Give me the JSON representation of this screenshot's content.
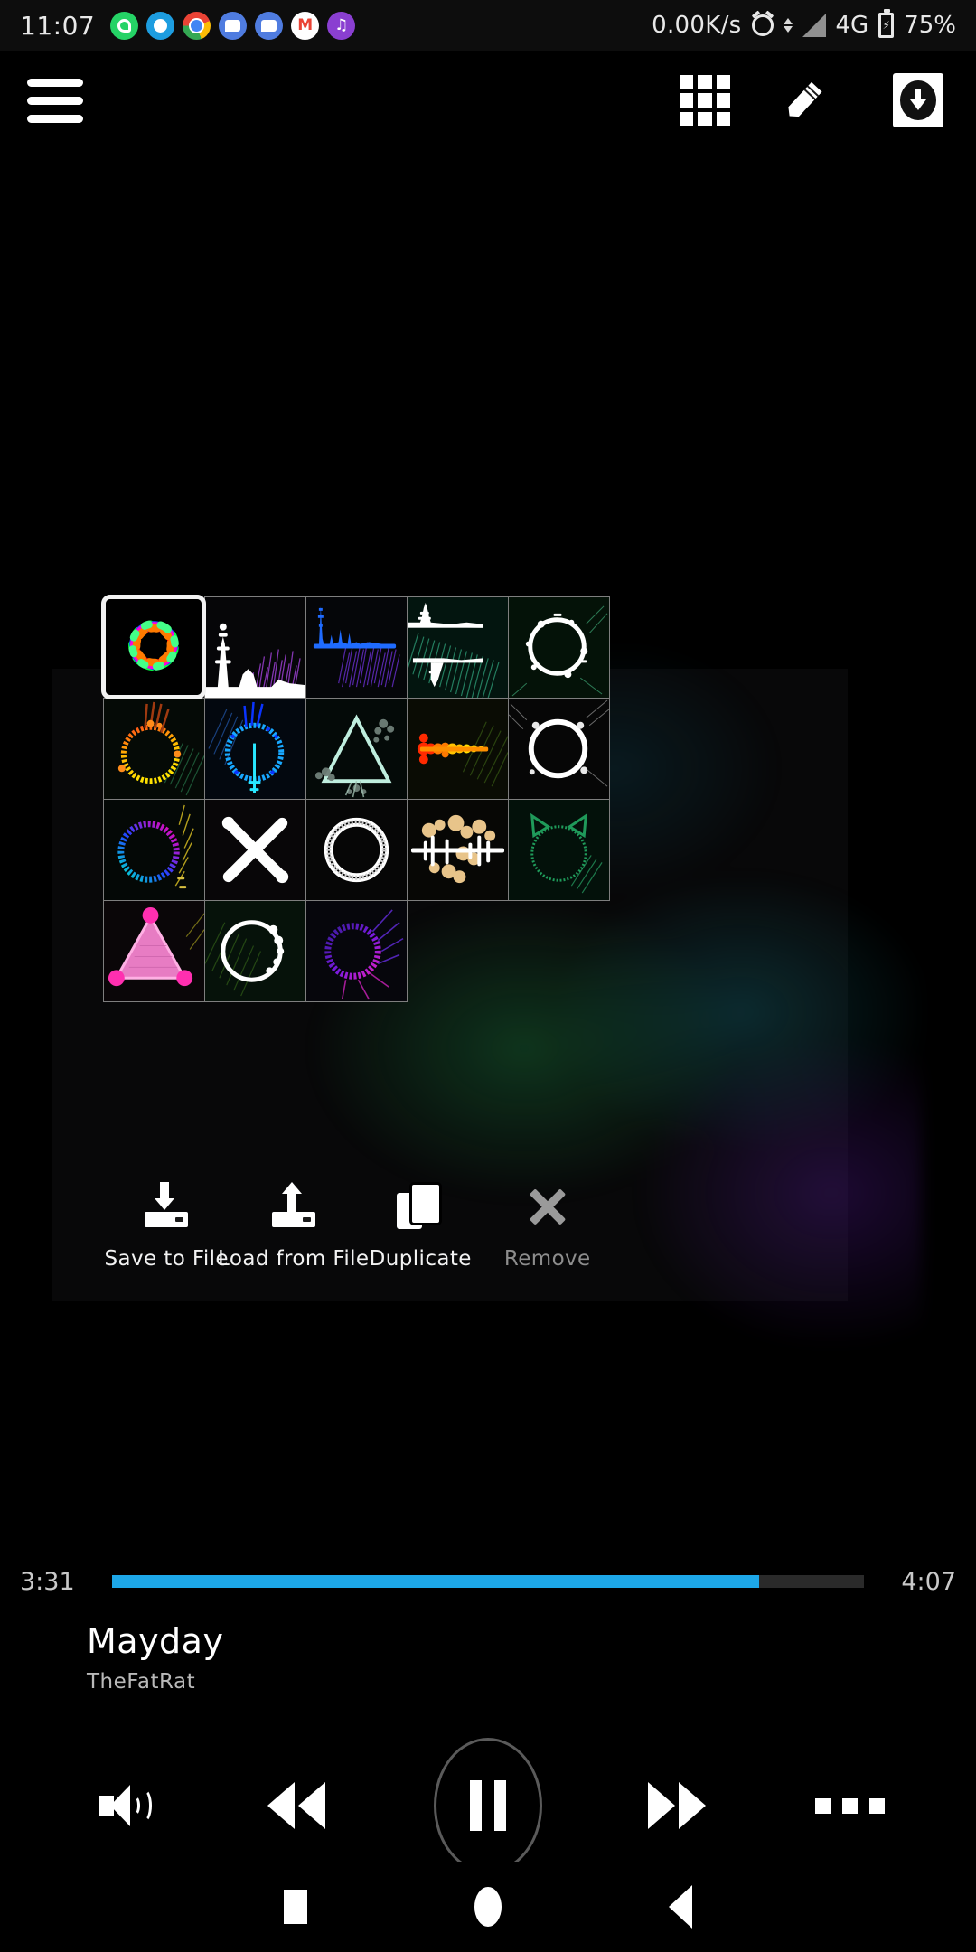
{
  "status_bar": {
    "clock": "11:07",
    "app_icons": [
      "whatsapp-icon",
      "blue-ring-icon",
      "chrome-icon",
      "messages-icon",
      "messages-icon",
      "gmail-icon",
      "music-icon"
    ],
    "network_speed": "0.00K/s",
    "alarm": "alarm-icon",
    "data_sync": "data-sync-icon",
    "signal": "signal-icon",
    "network_type": "4G",
    "battery": "battery-charging-icon",
    "battery_percent": "75%"
  },
  "toolbar": {
    "menu": "hamburger-menu-icon",
    "grid": "grid-view-icon",
    "edit": "pencil-edit-icon",
    "download": "download-icon"
  },
  "presets": {
    "selected_index": 0,
    "columns": 5,
    "rows": 4,
    "items": [
      {
        "index": 0,
        "name": "rainbow-flower-burst",
        "shape": "flower",
        "colors": [
          "#ff0000",
          "#ffee00",
          "#00ff44",
          "#00e5ff",
          "#2244ff",
          "#ff00dd"
        ],
        "selected": true
      },
      {
        "index": 1,
        "name": "white-terrain-spectrum",
        "shape": "terrain",
        "colors": [
          "#ffffff",
          "#b048d8",
          "#7a2fb0"
        ],
        "selected": false
      },
      {
        "index": 2,
        "name": "blue-spike-waveform",
        "shape": "wave",
        "colors": [
          "#1f6bff",
          "#6a2fd0",
          "#1da7e8"
        ],
        "selected": false
      },
      {
        "index": 3,
        "name": "twin-white-ridges",
        "shape": "ridges",
        "colors": [
          "#ffffff",
          "#1f8f7a",
          "#2fa07a"
        ],
        "selected": false
      },
      {
        "index": 4,
        "name": "white-ring-spark",
        "shape": "ring",
        "colors": [
          "#ffffff",
          "#55e0a0"
        ],
        "selected": false
      },
      {
        "index": 5,
        "name": "warm-gradient-ring",
        "shape": "ring",
        "colors": [
          "#ff4a1a",
          "#ffb800",
          "#ffe100",
          "#8a4b1a"
        ],
        "selected": false
      },
      {
        "index": 6,
        "name": "blue-split-ring",
        "shape": "ring",
        "colors": [
          "#0a34ff",
          "#18a8ff",
          "#28e6ff"
        ],
        "selected": false
      },
      {
        "index": 7,
        "name": "mint-triangle",
        "shape": "triangle",
        "colors": [
          "#9fe8d8",
          "#cfeee4",
          "#6a7a72"
        ],
        "selected": false
      },
      {
        "index": 8,
        "name": "red-orange-waveform",
        "shape": "wave",
        "colors": [
          "#ff1500",
          "#ff7a00",
          "#ffd000"
        ],
        "selected": false
      },
      {
        "index": 9,
        "name": "white-glow-ring",
        "shape": "ring",
        "colors": [
          "#ffffff",
          "#d8d8d8"
        ],
        "selected": false
      },
      {
        "index": 10,
        "name": "cyan-magenta-ring",
        "shape": "ring",
        "colors": [
          "#00e6c8",
          "#2244ff",
          "#ff00b0"
        ],
        "selected": false
      },
      {
        "index": 11,
        "name": "white-x-cross",
        "shape": "cross",
        "colors": [
          "#ffffff"
        ],
        "selected": false
      },
      {
        "index": 12,
        "name": "white-thick-ring",
        "shape": "ring",
        "colors": [
          "#ffffff",
          "#cccccc"
        ],
        "selected": false
      },
      {
        "index": 13,
        "name": "tan-scatter-waveform",
        "shape": "wave",
        "colors": [
          "#e8c48a",
          "#ffffff"
        ],
        "selected": false
      },
      {
        "index": 14,
        "name": "green-cat-ring",
        "shape": "ring",
        "colors": [
          "#1a9a5a",
          "#2fbf77"
        ],
        "selected": false
      },
      {
        "index": 15,
        "name": "pink-triangle",
        "shape": "triangle",
        "colors": [
          "#ff8ad8",
          "#ff2fb0"
        ],
        "selected": false
      },
      {
        "index": 16,
        "name": "white-dotted-ring",
        "shape": "ring",
        "colors": [
          "#ffffff"
        ],
        "selected": false
      },
      {
        "index": 17,
        "name": "purple-magenta-ring",
        "shape": "ring",
        "colors": [
          "#7a1adf",
          "#e020c0",
          "#3a1a9a"
        ],
        "selected": false
      }
    ]
  },
  "actions": [
    {
      "name": "save-to-file",
      "label": "Save to File",
      "icon": "save-download-icon",
      "disabled": false
    },
    {
      "name": "load-from-file",
      "label": "Load from File",
      "icon": "load-upload-icon",
      "disabled": false
    },
    {
      "name": "duplicate",
      "label": "Duplicate",
      "icon": "duplicate-icon",
      "disabled": false
    },
    {
      "name": "remove",
      "label": "Remove",
      "icon": "close-x-icon",
      "disabled": true
    }
  ],
  "player": {
    "elapsed": "3:31",
    "duration": "4:07",
    "progress_percent": 86,
    "progress_color": "#1da7e8",
    "title": "Mayday",
    "artist": "TheFatRat",
    "controls": [
      {
        "name": "volume-button",
        "icon": "volume-icon"
      },
      {
        "name": "rewind-button",
        "icon": "rewind-icon"
      },
      {
        "name": "play-pause-button",
        "icon": "pause-icon"
      },
      {
        "name": "forward-button",
        "icon": "fast-forward-icon"
      },
      {
        "name": "more-options-button",
        "icon": "more-dots-icon"
      }
    ]
  },
  "nav_bar": {
    "recents": "square-recents-icon",
    "home": "circle-home-icon",
    "back": "triangle-back-icon"
  }
}
